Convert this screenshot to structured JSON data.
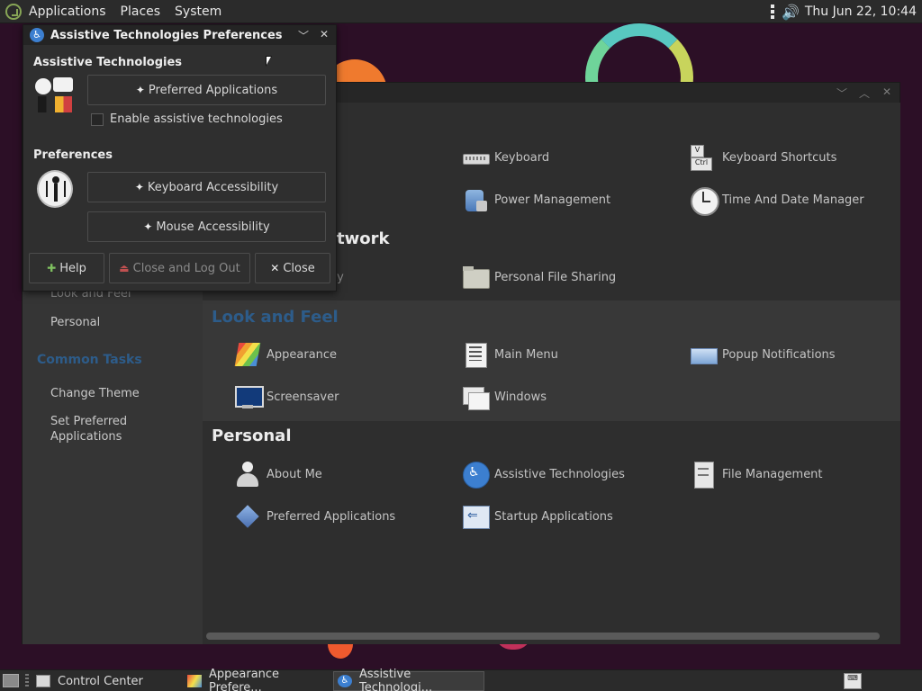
{
  "top_panel": {
    "menus": [
      "Applications",
      "Places",
      "System"
    ],
    "clock": "Thu Jun 22, 10:44"
  },
  "control_center": {
    "partial_heading_network": "twork",
    "partial_item_network": "ky",
    "sections": {
      "hardware_items": [
        {
          "label": "Keyboard",
          "icon": "keyboard-icon"
        },
        {
          "label": "Keyboard Shortcuts",
          "icon": "keyboard-shortcuts-icon"
        },
        {
          "label": "Power Management",
          "icon": "power-management-icon"
        },
        {
          "label": "Time And Date Manager",
          "icon": "clock-icon"
        }
      ],
      "network_items": [
        {
          "label": "Personal File Sharing",
          "icon": "folder-share-icon"
        }
      ],
      "look_and_feel": {
        "title": "Look and Feel",
        "items": [
          {
            "label": "Appearance",
            "icon": "appearance-icon"
          },
          {
            "label": "Main Menu",
            "icon": "main-menu-icon"
          },
          {
            "label": "Popup Notifications",
            "icon": "notification-icon"
          },
          {
            "label": "Screensaver",
            "icon": "screensaver-icon"
          },
          {
            "label": "Windows",
            "icon": "windows-icon"
          }
        ]
      },
      "personal": {
        "title": "Personal",
        "items": [
          {
            "label": "About Me",
            "icon": "about-me-icon"
          },
          {
            "label": "Assistive Technologies",
            "icon": "accessibility-icon"
          },
          {
            "label": "File Management",
            "icon": "file-management-icon"
          },
          {
            "label": "Preferred Applications",
            "icon": "preferred-apps-icon"
          },
          {
            "label": "Startup Applications",
            "icon": "startup-icon"
          }
        ]
      }
    },
    "sidebar": {
      "partial_item": "Look and Feel",
      "items": [
        "Personal"
      ],
      "common_tasks_title": "Common Tasks",
      "tasks": [
        "Change Theme",
        "Set Preferred Applications"
      ]
    }
  },
  "dialog": {
    "title": "Assistive Technologies Preferences",
    "section_assistive": "Assistive Technologies",
    "preferred_apps_button": "Preferred Applications",
    "enable_checkbox": {
      "label": "Enable assistive technologies",
      "checked": false
    },
    "section_preferences": "Preferences",
    "keyboard_button": "Keyboard Accessibility",
    "mouse_button": "Mouse Accessibility",
    "help_button": "Help",
    "logout_button": "Close and Log Out",
    "close_button": "Close"
  },
  "taskbar": {
    "tasks": [
      {
        "label": "Control Center"
      },
      {
        "label": "Appearance Prefere..."
      },
      {
        "label": "Assistive Technologi..."
      }
    ]
  }
}
